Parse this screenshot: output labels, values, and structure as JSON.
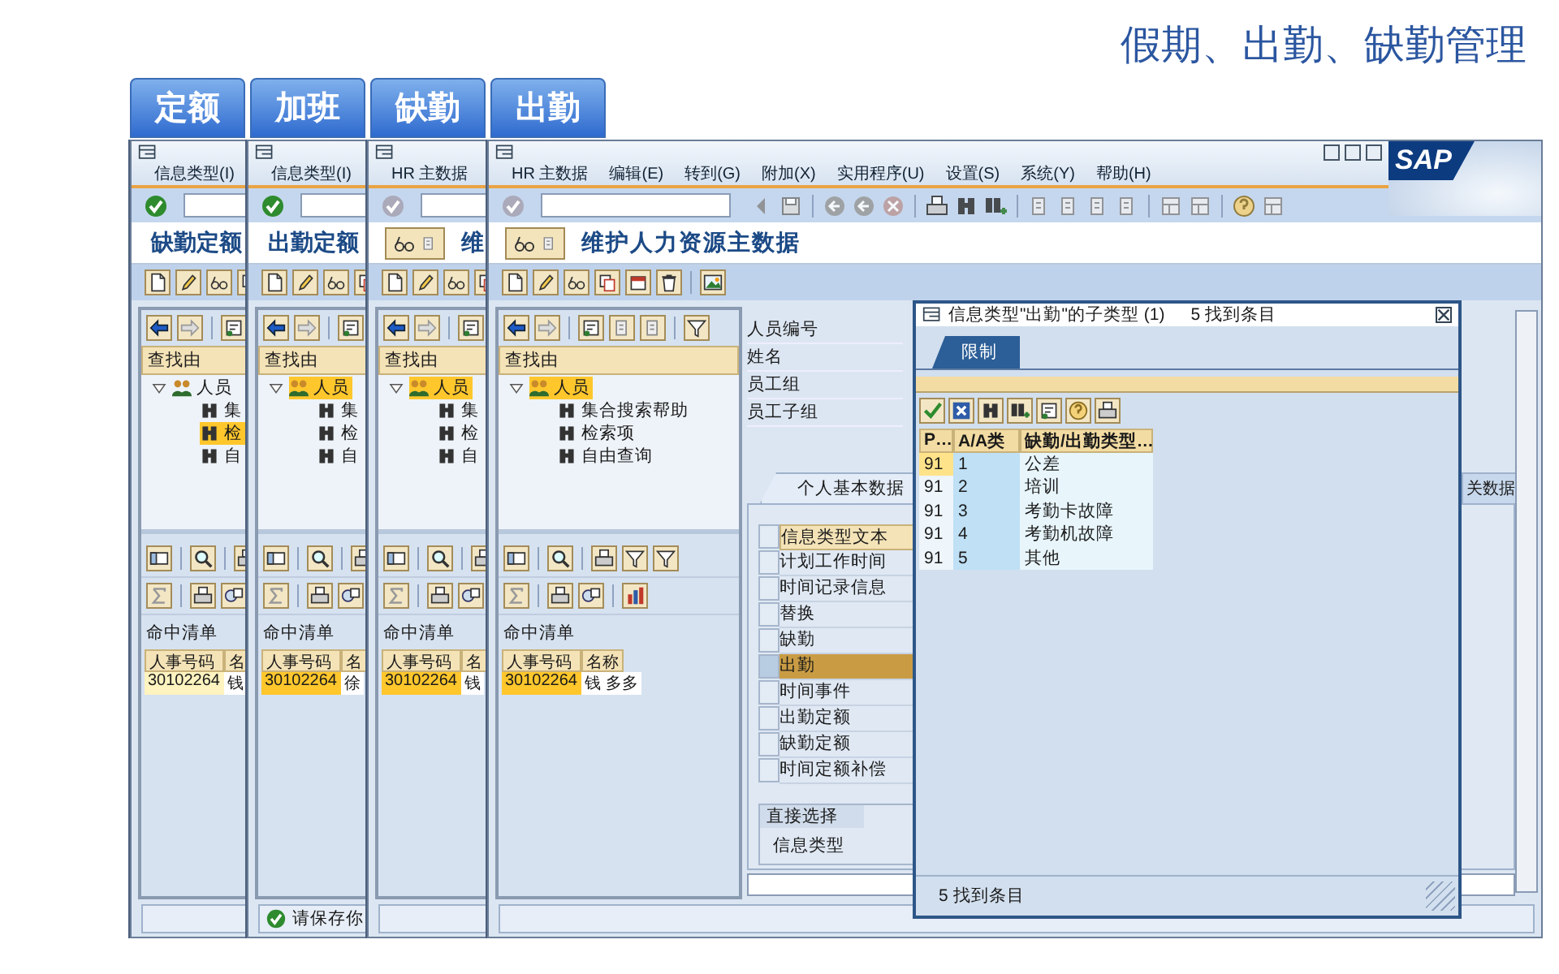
{
  "header": {
    "title": "假期、出勤、缺勤管理"
  },
  "section_buttons": [
    "定额",
    "加班",
    "缺勤",
    "出勤"
  ],
  "windows": [
    {
      "menu": [
        "信息类型(I)"
      ],
      "enter_enabled": true,
      "title": "缺勤定额",
      "title_button": false,
      "search_header": "查找由",
      "tree": {
        "label": "人员",
        "selected": false,
        "children": [
          {
            "label": "集",
            "selected": false
          },
          {
            "label": "检",
            "selected": true
          },
          {
            "label": "自",
            "selected": false
          }
        ]
      },
      "hit_list": {
        "title": "命中清单",
        "columns": [
          "人事号码",
          "名"
        ],
        "rows": [
          {
            "cells": [
              "30102264",
              "钱"
            ],
            "selected": false
          }
        ]
      }
    },
    {
      "menu": [
        "信息类型(I)"
      ],
      "enter_enabled": true,
      "title": "出勤定额",
      "title_button": false,
      "search_header": "查找由",
      "tree": {
        "label": "人员",
        "selected": true,
        "children": [
          {
            "label": "集",
            "selected": false
          },
          {
            "label": "检",
            "selected": false
          },
          {
            "label": "自",
            "selected": false
          }
        ]
      },
      "hit_list": {
        "title": "命中清单",
        "columns": [
          "人事号码",
          "名"
        ],
        "rows": [
          {
            "cells": [
              "30102264",
              "徐"
            ],
            "selected": true
          }
        ]
      },
      "status": {
        "kind": "success",
        "text": "请保存你"
      }
    },
    {
      "menu": [
        "HR 主数据"
      ],
      "enter_enabled": false,
      "title": "维",
      "title_button": true,
      "search_header": "查找由",
      "tree": {
        "label": "人员",
        "selected": true,
        "children": [
          {
            "label": "集",
            "selected": false
          },
          {
            "label": "检",
            "selected": false
          },
          {
            "label": "自",
            "selected": false
          }
        ]
      },
      "hit_list": {
        "title": "命中清单",
        "columns": [
          "人事号码",
          "名"
        ],
        "rows": [
          {
            "cells": [
              "30102264",
              "钱"
            ],
            "selected": true
          }
        ]
      }
    },
    {
      "menu": [
        "HR 主数据",
        "编辑(E)",
        "转到(G)",
        "附加(X)",
        "实用程序(U)",
        "设置(S)",
        "系统(Y)",
        "帮助(H)"
      ],
      "enter_enabled": false,
      "title": "维护人力资源主数据",
      "title_button": true,
      "logo": "SAP",
      "search_header": "查找由",
      "tree": {
        "label": "人员",
        "selected": true,
        "children": [
          {
            "label": "集合搜索帮助",
            "selected": false
          },
          {
            "label": "检索项",
            "selected": false
          },
          {
            "label": "自由查询",
            "selected": false
          }
        ]
      },
      "hit_list": {
        "title": "命中清单",
        "columns": [
          "人事号码",
          "名称"
        ],
        "rows": [
          {
            "cells": [
              "30102264",
              "钱 多多"
            ],
            "selected": true
          }
        ]
      },
      "main": {
        "fields": [
          "人员编号",
          "姓名",
          "员工组",
          "员工子组"
        ],
        "tabs": [
          {
            "label": "个人基本数据",
            "selected": true
          },
          {
            "label": "关数据",
            "selected": false
          }
        ],
        "infotypes": {
          "header": "信息类型文本",
          "rows": [
            {
              "label": "计划工作时间",
              "selected": false
            },
            {
              "label": "时间记录信息",
              "selected": false
            },
            {
              "label": "替换",
              "selected": false
            },
            {
              "label": "缺勤",
              "selected": false
            },
            {
              "label": "出勤",
              "selected": true
            },
            {
              "label": "时间事件",
              "selected": false
            },
            {
              "label": "出勤定额",
              "selected": false
            },
            {
              "label": "缺勤定额",
              "selected": false
            },
            {
              "label": "时间定额补偿",
              "selected": false
            }
          ]
        },
        "direct_selection": {
          "title": "直接选择",
          "label": "信息类型"
        }
      }
    }
  ],
  "popup": {
    "title": "信息类型\"出勤\"的子类型 (1)",
    "count": "5 找到条目",
    "tab": "限制",
    "columns": [
      "P…",
      "A/A类",
      "缺勤/出勤类型…"
    ],
    "rows": [
      {
        "cells": [
          "91",
          "1",
          "公差"
        ],
        "selected": true
      },
      {
        "cells": [
          "91",
          "2",
          "培训"
        ],
        "selected": false
      },
      {
        "cells": [
          "91",
          "3",
          "考勤卡故障"
        ],
        "selected": false
      },
      {
        "cells": [
          "91",
          "4",
          "考勤机故障"
        ],
        "selected": false
      },
      {
        "cells": [
          "91",
          "5",
          "其他"
        ],
        "selected": false
      }
    ],
    "status": "5 找到条目"
  }
}
